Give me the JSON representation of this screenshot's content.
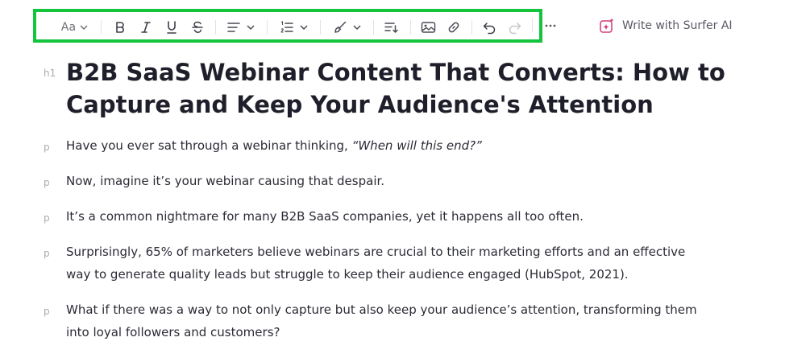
{
  "toolbar": {
    "text_style_label": "Aa",
    "buttons": [
      "text-style",
      "bold",
      "italic",
      "underline",
      "strikethrough",
      "align",
      "numbered-list",
      "highlight",
      "line-height",
      "image",
      "link",
      "undo",
      "redo",
      "more"
    ],
    "accent_color": "#14c43c"
  },
  "ai": {
    "label": "Write with Surfer AI",
    "icon": "sparkle-icon"
  },
  "document": {
    "heading": {
      "tag": "h1",
      "text": "B2B SaaS Webinar Content That Converts: How to Capture and Keep Your Audience's Attention"
    },
    "paragraphs": [
      {
        "tag": "p",
        "text": "Have you ever sat through a webinar thinking, ",
        "italic": "“When will this end?”"
      },
      {
        "tag": "p",
        "text": "Now, imagine it’s your webinar causing that despair."
      },
      {
        "tag": "p",
        "text": "It’s a common nightmare for many B2B SaaS companies, yet it happens all too often."
      },
      {
        "tag": "p",
        "text": "Surprisingly, 65% of marketers believe webinars are crucial to their marketing efforts and an effective way to generate quality leads but struggle to keep their audience engaged (HubSpot, 2021)."
      },
      {
        "tag": "p",
        "text": "What if there was a way to not only capture but also keep your audience’s attention, transforming them into loyal followers and customers?"
      }
    ]
  }
}
